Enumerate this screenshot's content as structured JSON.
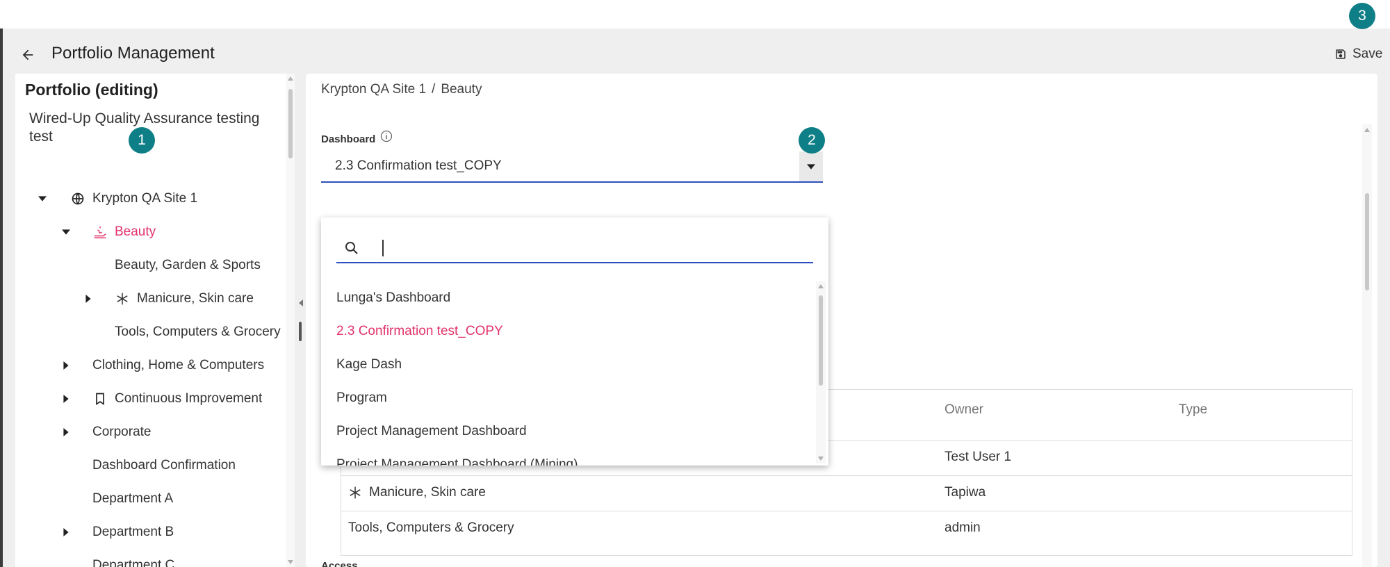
{
  "colors": {
    "accent": "#e2336b",
    "callout": "#0f7f87",
    "underline": "#2d4fbf",
    "background": "#efefef"
  },
  "header": {
    "title": "Portfolio Management",
    "back_icon": "arrow-left-icon",
    "save_label": "Save",
    "save_icon": "floppy-disk-icon"
  },
  "callouts": [
    "1",
    "2",
    "3"
  ],
  "left_panel": {
    "heading": "Portfolio (editing)",
    "portfolio_name": "Wired-Up Quality Assurance testing test",
    "tree": [
      {
        "label": "Krypton QA Site 1",
        "icon": "globe-icon",
        "expanded": true
      },
      {
        "label": "Beauty",
        "icon": "hand-care-icon",
        "expanded": true,
        "selected": true
      },
      {
        "label": "Beauty, Garden & Sports"
      },
      {
        "label": "Manicure, Skin care",
        "icon": "asterisk-icon",
        "expanded": false
      },
      {
        "label": "Tools, Computers & Grocery"
      },
      {
        "label": "Clothing, Home & Computers",
        "expanded": false
      },
      {
        "label": "Continuous Improvement",
        "icon": "bookmark-icon",
        "expanded": false
      },
      {
        "label": "Corporate",
        "expanded": false
      },
      {
        "label": "Dashboard Confirmation"
      },
      {
        "label": "Department A"
      },
      {
        "label": "Department B",
        "expanded": false
      },
      {
        "label": "Department C"
      }
    ]
  },
  "breadcrumb": [
    "Krypton QA Site 1",
    "/",
    "Beauty"
  ],
  "dashboard": {
    "label": "Dashboard",
    "info_icon": "info-circle-icon",
    "selected": "2.3 Confirmation test_COPY",
    "search_placeholder": "",
    "search_value": "",
    "options": [
      "Lunga's Dashboard",
      "2.3 Confirmation test_COPY",
      "Kage Dash",
      "Program",
      "Project Management Dashboard",
      "Project Management Dashboard (Mining)"
    ]
  },
  "table": {
    "columns": [
      "Owner",
      "Type"
    ],
    "rows": [
      {
        "name": "",
        "icon": "",
        "owner": "Test User 1",
        "type": ""
      },
      {
        "name": "Manicure, Skin care",
        "icon": "asterisk-icon",
        "owner": "Tapiwa",
        "type": ""
      },
      {
        "name": "Tools, Computers & Grocery",
        "icon": "",
        "owner": "admin",
        "type": ""
      }
    ]
  },
  "access_label": "Access"
}
